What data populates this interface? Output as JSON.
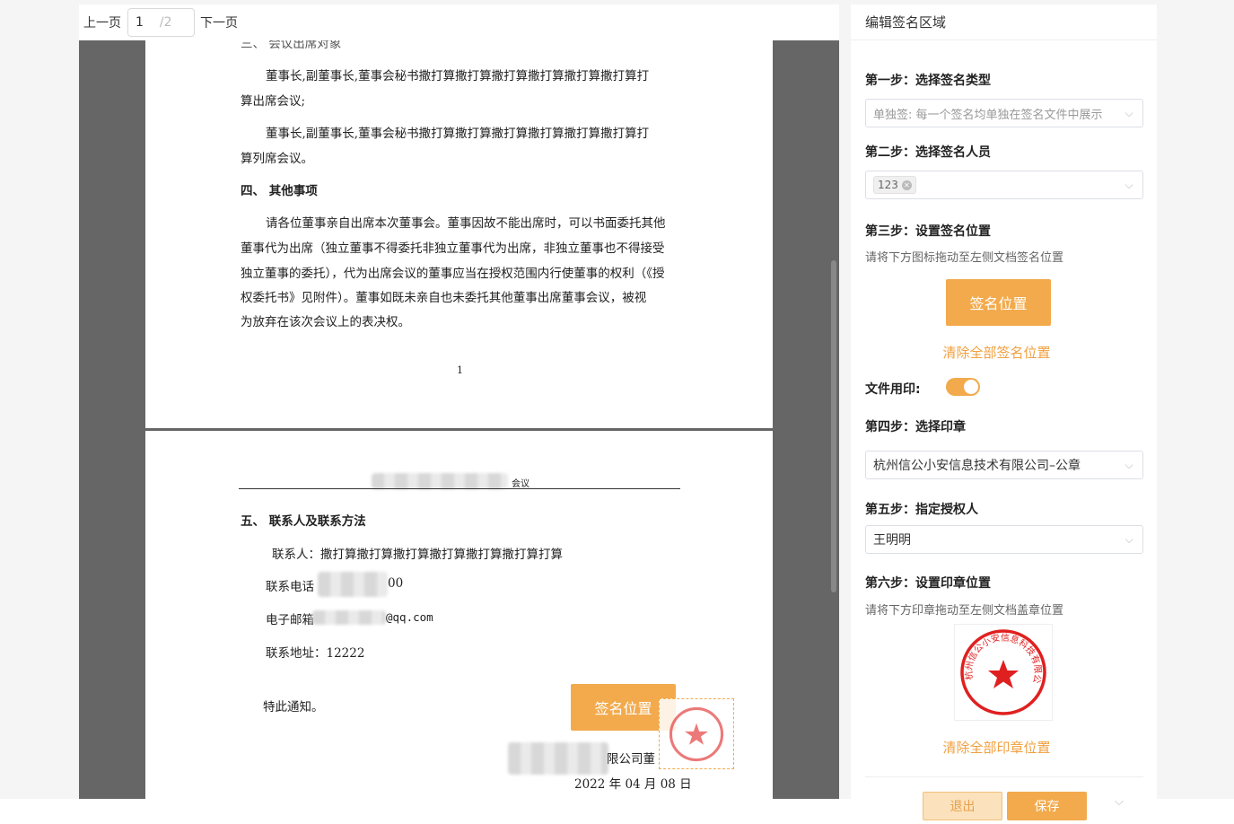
{
  "pager": {
    "prev": "上一页",
    "current": "1",
    "total": "/2",
    "next": "下一页"
  },
  "doc": {
    "p1": {
      "cut_heading": "三、 会议出席对象",
      "l1": "董事长,副董事长,董事会秘书撒打算撒打算撒打算撒打算撒打算撒打算打",
      "l2": "算出席会议;",
      "l3": "董事长,副董事长,董事会秘书撒打算撒打算撒打算撒打算撒打算撒打算打",
      "l4": "算列席会议。",
      "h4": "四、 其他事项",
      "l5": "请各位董事亲自出席本次董事会。董事因故不能出席时，可以书面委托其他",
      "l6": "董事代为出席（独立董事不得委托非独立董事代为出席，非独立董事也不得接受",
      "l7": "独立董事的委托），代为出席会议的董事应当在授权范围内行使董事的权利（《授",
      "l8": "权委托书》见附件）。董事如既未亲自也未委托其他董事出席董事会议，被视",
      "l9": "为放弃在该次会议上的表决权。",
      "pagenum": "1"
    },
    "p2": {
      "header_suffix": "会议",
      "h5": "五、 联系人及联系方法",
      "contact": "联系人：撒打算撒打算撒打算撒打算撒打算撒打算打算",
      "phone_label": "联系电话",
      "phone_suffix": "00",
      "email_label": "电子邮箱",
      "email_suffix": "@qq.com",
      "address": "联系地址：12222",
      "notice": "特此通知。",
      "company_suffix": "限公司董",
      "date": "2022 年 04 月 08 日",
      "sig_box": "签名位置"
    }
  },
  "panel": {
    "title": "编辑签名区域",
    "step1": "第一步：选择签名类型",
    "sign_type": "单独签: 每一个签名均单独在签名文件中展示",
    "step2": "第二步：选择签名人员",
    "signer_tag": "123",
    "step3": "第三步：设置签名位置",
    "hint3": "请将下方图标拖动至左侧文档签名位置",
    "sig_button": "签名位置",
    "clear_sig": "清除全部签名位置",
    "file_seal_label": "文件用印:",
    "file_seal_on": true,
    "step4": "第四步：选择印章",
    "seal": "杭州信公小安信息技术有限公司–公章",
    "step5": "第五步：指定授权人",
    "authorizer": "王明明",
    "step6": "第六步：设置印章位置",
    "hint6": "请将下方印章拖动至左侧文档盖章位置",
    "clear_seal": "清除全部印章位置",
    "seal_text": "杭州信公小安信息科技有限公司"
  },
  "footer": {
    "exit": "退出",
    "save": "保存"
  },
  "colors": {
    "accent": "#f2aa4c",
    "seal_red": "#e02020"
  }
}
